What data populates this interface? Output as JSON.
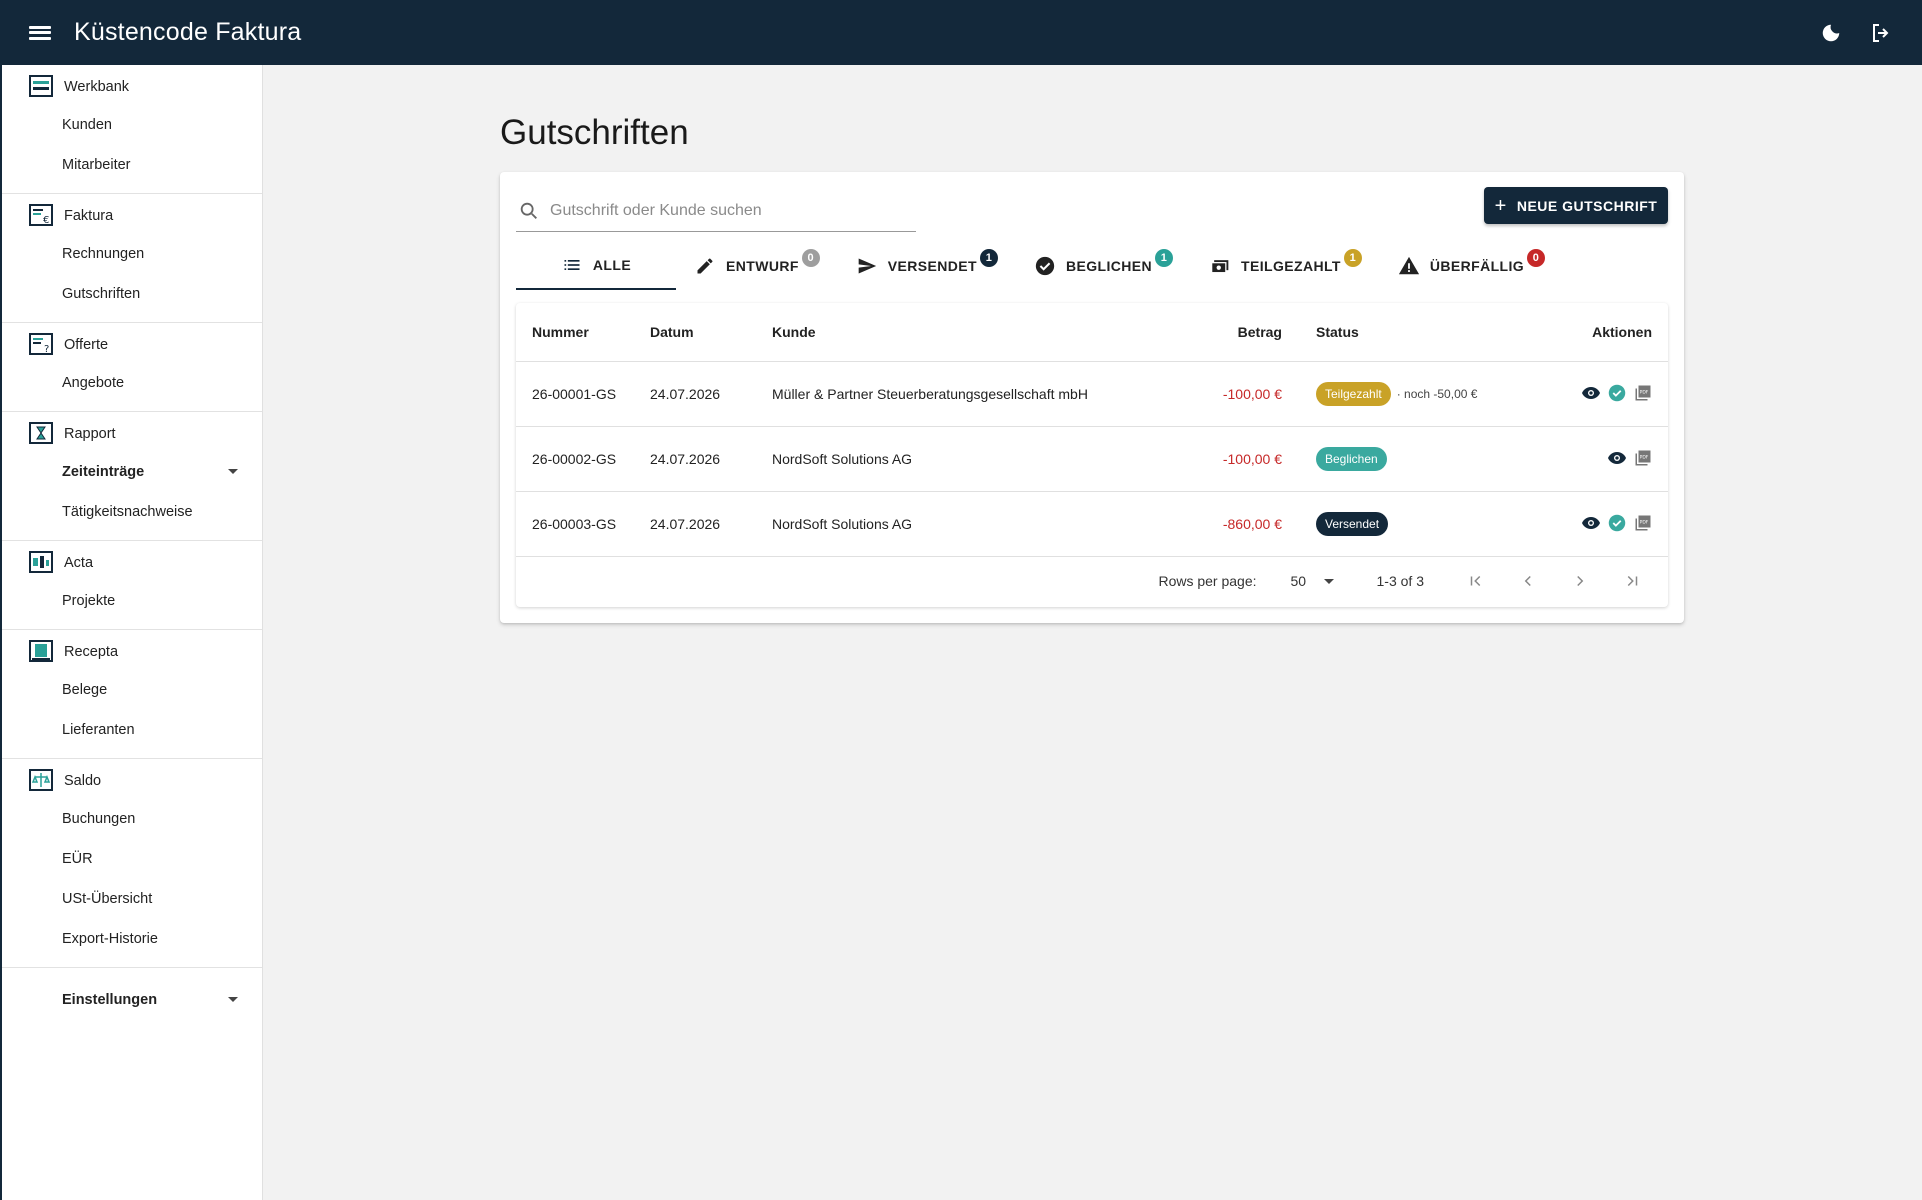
{
  "app": {
    "title": "Küstencode Faktura"
  },
  "header_icons": [
    "menu-icon",
    "dark-mode-icon",
    "logout-icon"
  ],
  "sidebar": {
    "groups": [
      {
        "label": "Werkbank",
        "icon": "werkbank-icon",
        "items": [
          {
            "label": "Kunden"
          },
          {
            "label": "Mitarbeiter"
          }
        ]
      },
      {
        "label": "Faktura",
        "icon": "faktura-icon",
        "items": [
          {
            "label": "Rechnungen"
          },
          {
            "label": "Gutschriften"
          }
        ]
      },
      {
        "label": "Offerte",
        "icon": "offerte-icon",
        "items": [
          {
            "label": "Angebote"
          }
        ]
      },
      {
        "label": "Rapport",
        "icon": "rapport-icon",
        "items": [
          {
            "label": "Zeiteinträge"
          },
          {
            "label": "Tätigkeitsnachweise"
          }
        ]
      },
      {
        "label": "Acta",
        "icon": "acta-icon",
        "items": [
          {
            "label": "Projekte"
          }
        ]
      },
      {
        "label": "Recepta",
        "icon": "recepta-icon",
        "items": [
          {
            "label": "Belege"
          },
          {
            "label": "Lieferanten"
          }
        ]
      },
      {
        "label": "Saldo",
        "icon": "saldo-icon",
        "items": [
          {
            "label": "Buchungen"
          },
          {
            "label": "EÜR"
          },
          {
            "label": "USt-Übersicht"
          },
          {
            "label": "Export-Historie"
          }
        ]
      }
    ],
    "settings": {
      "label": "Einstellungen"
    }
  },
  "page": {
    "title": "Gutschriften"
  },
  "search": {
    "placeholder": "Gutschrift oder Kunde suchen"
  },
  "new_button": {
    "label": "NEUE GUTSCHRIFT"
  },
  "tabs": [
    {
      "label": "ALLE",
      "icon": "list-icon",
      "badge": ""
    },
    {
      "label": "ENTWURF",
      "icon": "pencil-icon",
      "badge": "0",
      "badge_color": "#9e9e9e"
    },
    {
      "label": "VERSENDET",
      "icon": "send-icon",
      "badge": "1",
      "badge_color": "#13283a"
    },
    {
      "label": "BEGLICHEN",
      "icon": "check-circle-icon",
      "badge": "1",
      "badge_color": "#2aa198"
    },
    {
      "label": "TEILGEZAHLT",
      "icon": "money-icon",
      "badge": "1",
      "badge_color": "#c9a227"
    },
    {
      "label": "ÜBERFÄLLIG",
      "icon": "warning-icon",
      "badge": "0",
      "badge_color": "#c62828"
    }
  ],
  "table": {
    "headers": {
      "nummer": "Nummer",
      "datum": "Datum",
      "kunde": "Kunde",
      "betrag": "Betrag",
      "status": "Status",
      "aktionen": "Aktionen"
    },
    "rows": [
      {
        "nummer": "26-00001-GS",
        "datum": "24.07.2026",
        "kunde": "Müller & Partner Steuerberatungsgesellschaft mbH",
        "betrag": "-100,00 €",
        "status": "Teilgezahlt",
        "status_color": "#c9a227",
        "status_note": "· noch -50,00 €",
        "actions": [
          "view-icon",
          "mark-paid-icon",
          "pdf-icon"
        ]
      },
      {
        "nummer": "26-00002-GS",
        "datum": "24.07.2026",
        "kunde": "NordSoft Solutions AG",
        "betrag": "-100,00 €",
        "status": "Beglichen",
        "status_color": "#3aa99f",
        "status_note": "",
        "actions": [
          "view-icon",
          "pdf-icon"
        ]
      },
      {
        "nummer": "26-00003-GS",
        "datum": "24.07.2026",
        "kunde": "NordSoft Solutions AG",
        "betrag": "-860,00 €",
        "status": "Versendet",
        "status_color": "#13283a",
        "status_note": "",
        "actions": [
          "view-icon",
          "mark-paid-icon",
          "pdf-icon"
        ]
      }
    ]
  },
  "pagination": {
    "rows_per_page_label": "Rows per page:",
    "rows_per_page": "50",
    "range": "1-3 of 3"
  }
}
